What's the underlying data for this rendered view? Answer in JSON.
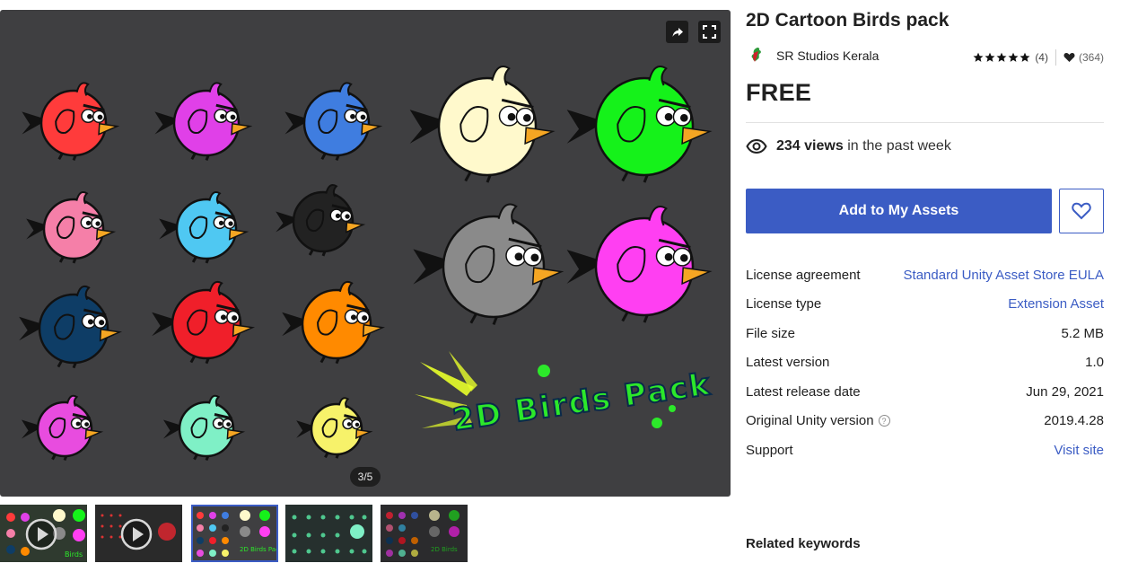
{
  "gallery": {
    "counter": "3/5",
    "banner_text": "2D Birds Pack",
    "share_icon": "share-icon",
    "fullscreen_icon": "fullscreen-icon",
    "thumbnails": [
      {
        "type": "video"
      },
      {
        "type": "video"
      },
      {
        "type": "image"
      },
      {
        "type": "image"
      },
      {
        "type": "image"
      }
    ]
  },
  "product": {
    "title": "2D Cartoon Birds pack",
    "publisher": "SR Studios Kerala",
    "rating_stars": 5,
    "rating_count": "(4)",
    "favorites": "(364)",
    "price": "FREE",
    "views_count": "234 views",
    "views_suffix": "in the past week",
    "add_button": "Add to My Assets"
  },
  "details": [
    {
      "key": "License agreement",
      "value": "Standard Unity Asset Store EULA",
      "link": true
    },
    {
      "key": "License type",
      "value": "Extension Asset",
      "link": true
    },
    {
      "key": "File size",
      "value": "5.2 MB",
      "link": false
    },
    {
      "key": "Latest version",
      "value": "1.0",
      "link": false
    },
    {
      "key": "Latest release date",
      "value": "Jun 29, 2021",
      "link": false
    },
    {
      "key": "Original Unity version",
      "value": "2019.4.28",
      "link": false,
      "help": true
    },
    {
      "key": "Support",
      "value": "Visit site",
      "link": true
    }
  ],
  "related_keywords_heading": "Related keywords",
  "colors": {
    "accent": "#3b5cc4",
    "viewer_bg": "#3f3f41",
    "birds": [
      "#ff3b3b",
      "#e040e8",
      "#3f7de0",
      "#f57fa8",
      "#4fc8f2",
      "#222222",
      "#0e3d66",
      "#f01f2a",
      "#ff8a00",
      "#e84cdf",
      "#7ff0c6",
      "#f7f26a",
      "#fff9cc",
      "#15f21a",
      "#8a8a8a",
      "#ff3ff2"
    ]
  }
}
